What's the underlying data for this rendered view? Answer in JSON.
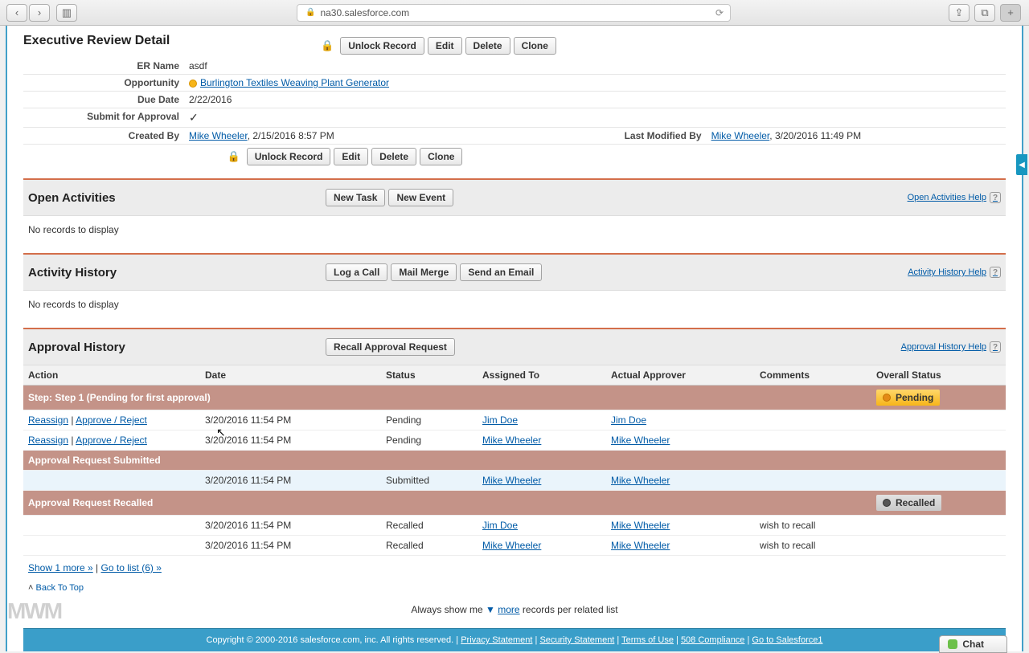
{
  "browser": {
    "url": "na30.salesforce.com"
  },
  "pageTitle": "Executive Review Detail",
  "buttons": {
    "unlock": "Unlock Record",
    "edit": "Edit",
    "delete": "Delete",
    "clone": "Clone",
    "newTask": "New Task",
    "newEvent": "New Event",
    "logCall": "Log a Call",
    "mailMerge": "Mail Merge",
    "sendEmail": "Send an Email",
    "recall": "Recall Approval Request"
  },
  "labels": {
    "erName": "ER Name",
    "opportunity": "Opportunity",
    "dueDate": "Due Date",
    "submitApproval": "Submit for Approval",
    "createdBy": "Created By",
    "lastModifiedBy": "Last Modified By"
  },
  "values": {
    "erName": "asdf",
    "opportunity": "Burlington Textiles Weaving Plant Generator",
    "dueDate": "2/22/2016",
    "createdByName": "Mike Wheeler",
    "createdByDate": ", 2/15/2016 8:57 PM",
    "modifiedByName": "Mike Wheeler",
    "modifiedByDate": ", 3/20/2016 11:49 PM"
  },
  "sections": {
    "openActivities": {
      "title": "Open Activities",
      "help": "Open Activities Help",
      "empty": "No records to display"
    },
    "activityHistory": {
      "title": "Activity History",
      "help": "Activity History Help",
      "empty": "No records to display"
    },
    "approvalHistory": {
      "title": "Approval History",
      "help": "Approval History Help"
    }
  },
  "approval": {
    "headers": {
      "action": "Action",
      "date": "Date",
      "status": "Status",
      "assignedTo": "Assigned To",
      "actualApprover": "Actual Approver",
      "comments": "Comments",
      "overallStatus": "Overall Status"
    },
    "actions": {
      "reassign": "Reassign",
      "approveReject": "Approve / Reject"
    },
    "step1": "Step: Step 1 (Pending for first approval)",
    "overallPending": "Pending",
    "rows1": [
      {
        "date": "3/20/2016 11:54 PM",
        "status": "Pending",
        "assigned": "Jim Doe",
        "approver": "Jim Doe"
      },
      {
        "date": "3/20/2016 11:54 PM",
        "status": "Pending",
        "assigned": "Mike Wheeler",
        "approver": "Mike Wheeler"
      }
    ],
    "submittedLabel": "Approval Request Submitted",
    "submittedRow": {
      "date": "3/20/2016 11:54 PM",
      "status": "Submitted",
      "assigned": "Mike Wheeler",
      "approver": "Mike Wheeler"
    },
    "recalledLabel": "Approval Request Recalled",
    "overallRecalled": "Recalled",
    "recalledRows": [
      {
        "date": "3/20/2016 11:54 PM",
        "status": "Recalled",
        "assigned": "Jim Doe",
        "approver": "Mike Wheeler",
        "comments": "wish to recall"
      },
      {
        "date": "3/20/2016 11:54 PM",
        "status": "Recalled",
        "assigned": "Mike Wheeler",
        "approver": "Mike Wheeler",
        "comments": "wish to recall"
      }
    ]
  },
  "listLinks": {
    "showMore": "Show 1 more »",
    "sep": " | ",
    "goToList": "Go to list (6) »"
  },
  "backTop": "Back To Top",
  "alwaysShow": {
    "prefix": "Always show me ",
    "more": "more",
    "suffix": " records per related list"
  },
  "footer": {
    "copy": "Copyright © 2000-2016 salesforce.com, inc. All rights reserved.",
    "links": [
      "Privacy Statement",
      "Security Statement",
      "Terms of Use",
      "508 Compliance",
      "Go to Salesforce1"
    ]
  },
  "chat": "Chat"
}
